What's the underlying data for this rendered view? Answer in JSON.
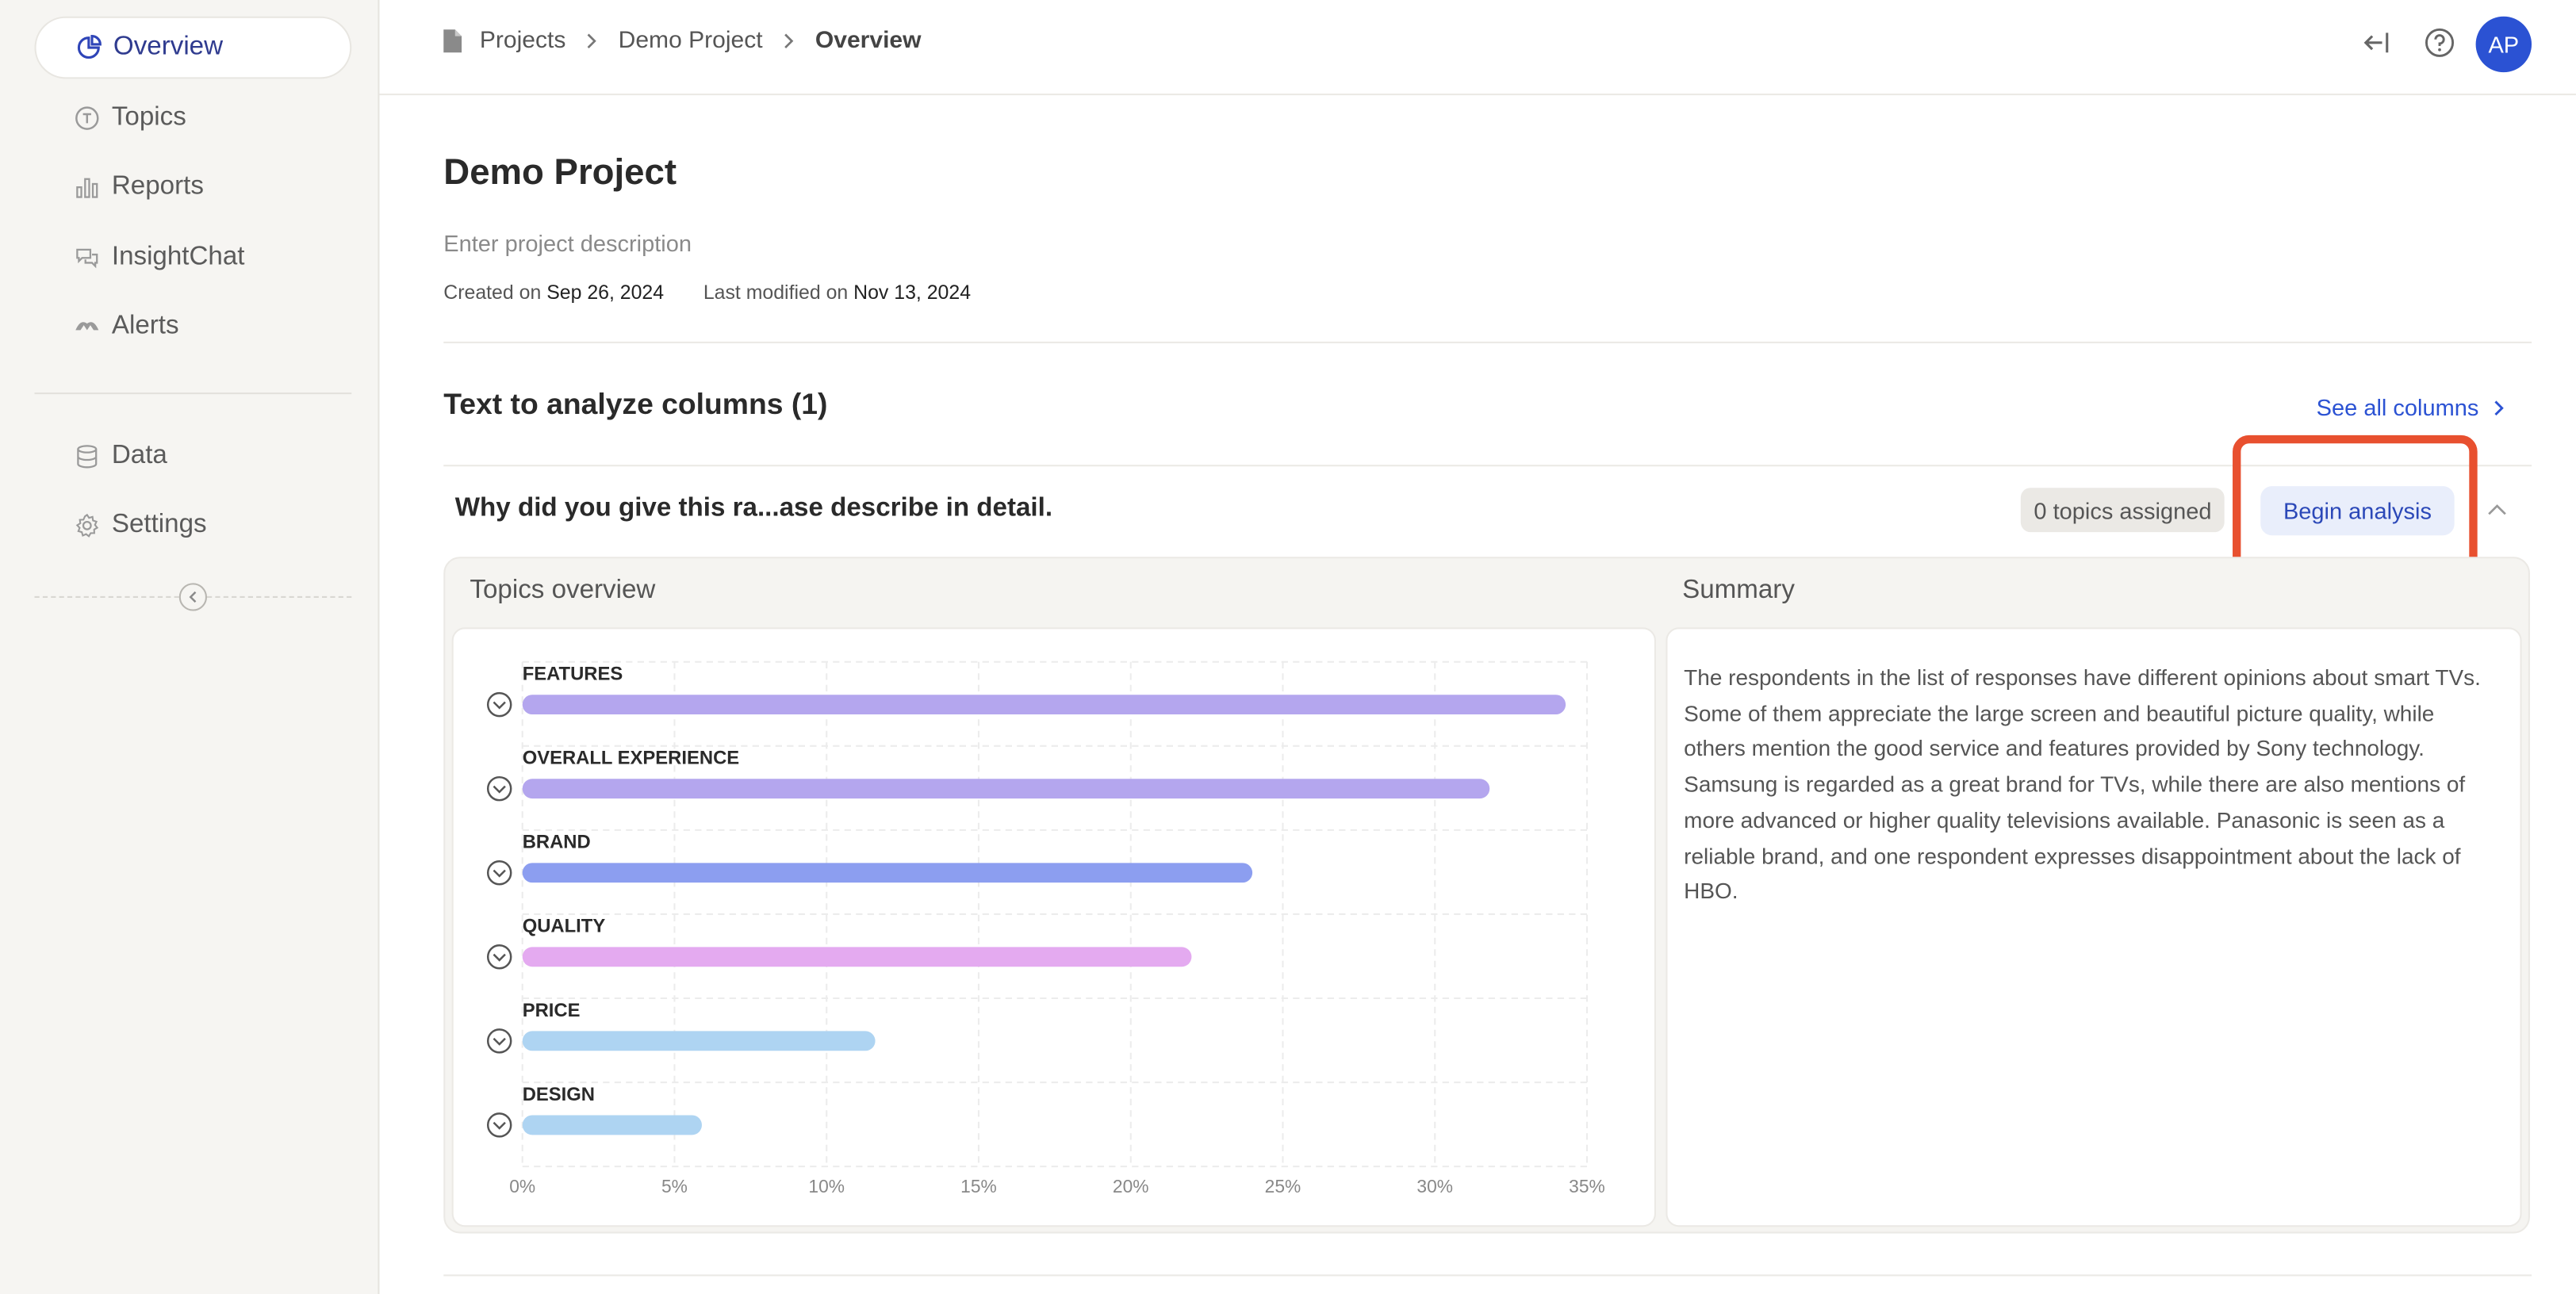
{
  "sidebar": {
    "items": [
      {
        "label": "Overview",
        "icon": "pie-chart-icon",
        "active": true
      },
      {
        "label": "Topics",
        "icon": "topics-icon"
      },
      {
        "label": "Reports",
        "icon": "bar-chart-icon"
      },
      {
        "label": "InsightChat",
        "icon": "chat-icon"
      },
      {
        "label": "Alerts",
        "icon": "alert-icon"
      },
      {
        "label": "Data",
        "icon": "database-icon"
      },
      {
        "label": "Settings",
        "icon": "gear-icon"
      }
    ]
  },
  "header": {
    "breadcrumb": [
      "Projects",
      "Demo Project",
      "Overview"
    ],
    "avatar_initials": "AP"
  },
  "project": {
    "title": "Demo Project",
    "description_placeholder": "Enter project description",
    "created_label": "Created on",
    "created_date": "Sep 26, 2024",
    "modified_label": "Last modified on",
    "modified_date": "Nov 13, 2024"
  },
  "columns_section": {
    "title": "Text to analyze columns (1)",
    "see_all_label": "See all columns",
    "column_title": "Why did you give this ra...ase describe in detail.",
    "topics_badge": "0 topics assigned",
    "begin_analysis_label": "Begin analysis"
  },
  "topics_overview": {
    "label": "Topics overview"
  },
  "summary": {
    "label": "Summary",
    "text": "The respondents in the list of responses have different opinions about smart TVs. Some of them appreciate the large screen and beautiful picture quality, while others mention the good service and features provided by Sony technology. Samsung is regarded as a great brand for TVs, while there are also mentions of more advanced or higher quality televisions available. Panasonic is seen as a reliable brand, and one respondent expresses disappointment about the lack of HBO."
  },
  "colors": {
    "accent": "#2b52d3",
    "highlight": "#e8502f"
  },
  "chart_data": {
    "type": "bar",
    "orientation": "horizontal",
    "categories": [
      "FEATURES",
      "OVERALL EXPERIENCE",
      "BRAND",
      "QUALITY",
      "PRICE",
      "DESIGN"
    ],
    "values": [
      34.3,
      31.8,
      24.0,
      22.0,
      11.6,
      5.9
    ],
    "bar_colors": [
      "#b4a6ee",
      "#b4a6ee",
      "#8c9ef0",
      "#e4aaf0",
      "#aed4f2",
      "#aed4f2"
    ],
    "x_ticks": [
      "0%",
      "5%",
      "10%",
      "15%",
      "20%",
      "25%",
      "30%",
      "35%"
    ],
    "xlim": [
      0,
      35
    ],
    "grid": true
  }
}
